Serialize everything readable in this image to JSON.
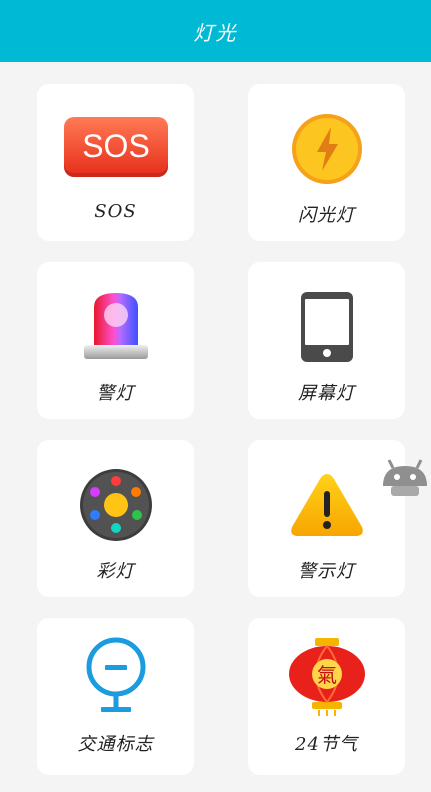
{
  "header": {
    "title": "灯光"
  },
  "items": [
    {
      "label": "SOS",
      "icon": "sos-icon",
      "badge_text": "SOS"
    },
    {
      "label": "闪光灯",
      "icon": "flash-icon"
    },
    {
      "label": "警灯",
      "icon": "police-siren-icon"
    },
    {
      "label": "屏幕灯",
      "icon": "phone-screen-icon"
    },
    {
      "label": "彩灯",
      "icon": "color-lights-icon"
    },
    {
      "label": "警示灯",
      "icon": "warning-icon"
    },
    {
      "label": "交通标志",
      "icon": "traffic-sign-icon"
    },
    {
      "label": "24节气",
      "icon": "lantern-icon",
      "lantern_char": "氣"
    }
  ],
  "colors": {
    "header": "#00b9d4",
    "background": "#f4f4f4",
    "card": "#ffffff"
  }
}
